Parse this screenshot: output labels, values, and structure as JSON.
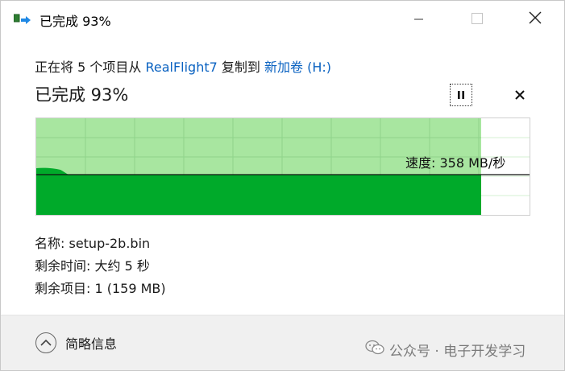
{
  "window": {
    "title": "已完成 93%",
    "icon": "copy-progress-icon"
  },
  "controls": {
    "minimize_icon": "minimize-icon",
    "maximize_icon": "maximize-icon",
    "close_icon": "close-icon"
  },
  "transfer": {
    "desc_prefix": "正在将 5 个项目从 ",
    "source": "RealFlight7",
    "desc_mid": " 复制到 ",
    "destination": "新加卷 (H:)",
    "status": "已完成 93%",
    "percent_complete": 93
  },
  "graph": {
    "speed_label": "速度: 358 MB/秒",
    "colors": {
      "filled_light": "#a8e6a0",
      "filled_dark": "#00aa2a",
      "grid": "#8fd38a",
      "speed_line": "#111111"
    }
  },
  "details": {
    "name": "名称: setup-2b.bin",
    "time_remaining": "剩余时间: 大约 5 秒",
    "items_remaining": "剩余项目: 1 (159 MB)"
  },
  "footer": {
    "toggle_label": "简略信息"
  },
  "watermark": {
    "text": "公众号 · 电子开发学习"
  }
}
